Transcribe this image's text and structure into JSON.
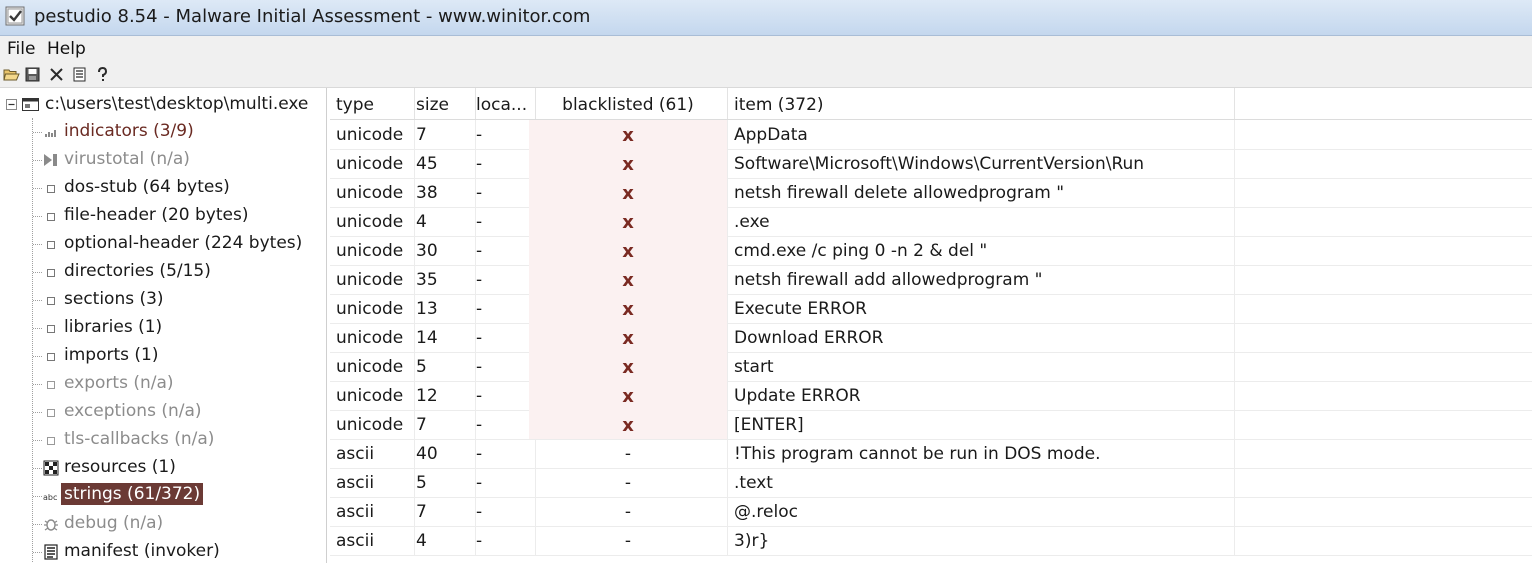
{
  "window": {
    "title": "pestudio 8.54 - Malware Initial Assessment - www.winitor.com"
  },
  "menu": {
    "file": "File",
    "help": "Help"
  },
  "toolbar": {
    "icons": [
      "open-folder-icon",
      "save-icon",
      "close-icon",
      "document-icon",
      "help-icon"
    ]
  },
  "tree": {
    "root": "c:\\users\\test\\desktop\\multi.exe",
    "nodes": [
      {
        "label": "indicators (3/9)",
        "icon": "indicators-icon"
      },
      {
        "label": "virustotal (n/a)",
        "icon": "virustotal-icon"
      },
      {
        "label": "dos-stub (64 bytes)",
        "icon": "node-icon"
      },
      {
        "label": "file-header (20 bytes)",
        "icon": "node-icon"
      },
      {
        "label": "optional-header (224 bytes)",
        "icon": "node-icon"
      },
      {
        "label": "directories (5/15)",
        "icon": "node-icon"
      },
      {
        "label": "sections (3)",
        "icon": "node-icon"
      },
      {
        "label": "libraries (1)",
        "icon": "node-icon"
      },
      {
        "label": "imports (1)",
        "icon": "node-icon"
      },
      {
        "label": "exports (n/a)",
        "icon": "node-icon"
      },
      {
        "label": "exceptions (n/a)",
        "icon": "node-icon"
      },
      {
        "label": "tls-callbacks (n/a)",
        "icon": "node-icon"
      },
      {
        "label": "resources (1)",
        "icon": "resources-icon"
      },
      {
        "label": "strings (61/372)",
        "icon": "strings-icon"
      },
      {
        "label": "debug (n/a)",
        "icon": "debug-icon"
      },
      {
        "label": "manifest (invoker)",
        "icon": "manifest-icon"
      }
    ],
    "selected": "strings (61/372)"
  },
  "table": {
    "columns": {
      "type": "type",
      "size": "size",
      "location": "loca...",
      "blacklisted": "blacklisted (61)",
      "item": "item (372)"
    },
    "rows": [
      {
        "type": "unicode",
        "size": "7",
        "location": "-",
        "blacklisted": "x",
        "item": "AppData"
      },
      {
        "type": "unicode",
        "size": "45",
        "location": "-",
        "blacklisted": "x",
        "item": "Software\\Microsoft\\Windows\\CurrentVersion\\Run"
      },
      {
        "type": "unicode",
        "size": "38",
        "location": "-",
        "blacklisted": "x",
        "item": "netsh firewall delete allowedprogram \""
      },
      {
        "type": "unicode",
        "size": "4",
        "location": "-",
        "blacklisted": "x",
        "item": ".exe"
      },
      {
        "type": "unicode",
        "size": "30",
        "location": "-",
        "blacklisted": "x",
        "item": "cmd.exe /c ping 0 -n 2 & del \""
      },
      {
        "type": "unicode",
        "size": "35",
        "location": "-",
        "blacklisted": "x",
        "item": "netsh firewall add allowedprogram \""
      },
      {
        "type": "unicode",
        "size": "13",
        "location": "-",
        "blacklisted": "x",
        "item": "Execute ERROR"
      },
      {
        "type": "unicode",
        "size": "14",
        "location": "-",
        "blacklisted": "x",
        "item": "Download ERROR"
      },
      {
        "type": "unicode",
        "size": "5",
        "location": "-",
        "blacklisted": "x",
        "item": "start"
      },
      {
        "type": "unicode",
        "size": "12",
        "location": "-",
        "blacklisted": "x",
        "item": "Update ERROR"
      },
      {
        "type": "unicode",
        "size": "7",
        "location": "-",
        "blacklisted": "x",
        "item": "[ENTER]"
      },
      {
        "type": "ascii",
        "size": "40",
        "location": "-",
        "blacklisted": "-",
        "item": "!This program cannot be run in DOS mode."
      },
      {
        "type": "ascii",
        "size": "5",
        "location": "-",
        "blacklisted": "-",
        "item": ".text"
      },
      {
        "type": "ascii",
        "size": "7",
        "location": "-",
        "blacklisted": "-",
        "item": "@.reloc"
      },
      {
        "type": "ascii",
        "size": "4",
        "location": "-",
        "blacklisted": "-",
        "item": "3)r}"
      }
    ]
  },
  "colors": {
    "selection": "#6b3a35",
    "blacklist_mark": "#7a2a22",
    "blacklist_bg": "#fbf1f1",
    "disabled_text": "#8c8c8c"
  }
}
